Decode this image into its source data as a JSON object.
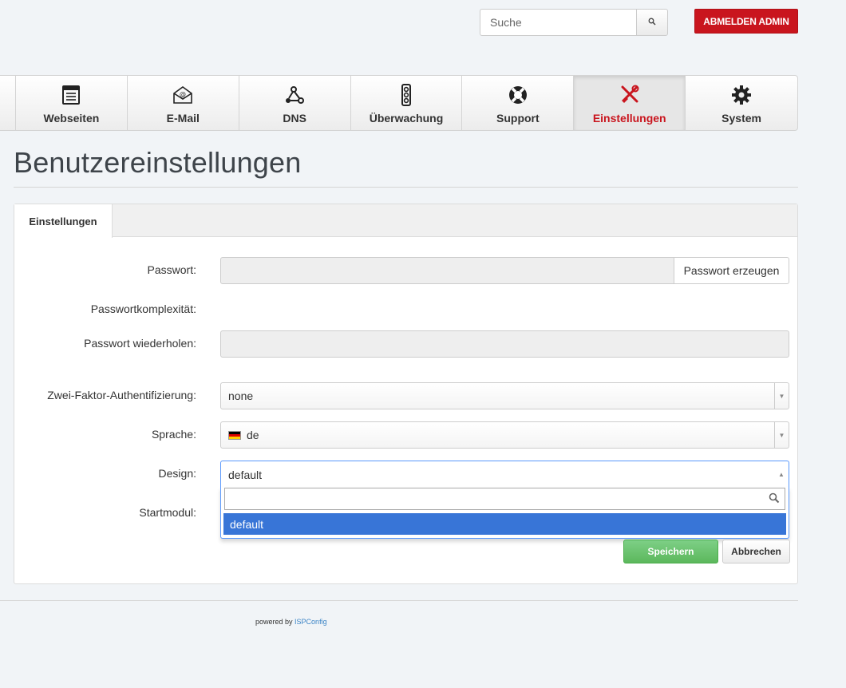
{
  "header": {
    "search_placeholder": "Suche",
    "search_button_icon": "search-icon",
    "logout_label": "ABMELDEN ADMIN",
    "logout_color": "#c9151e"
  },
  "nav": {
    "items": [
      {
        "label": "Webseiten",
        "icon": "web-page-icon",
        "active": false
      },
      {
        "label": "E-Mail",
        "icon": "email-envelope-icon",
        "active": false
      },
      {
        "label": "DNS",
        "icon": "network-nodes-icon",
        "active": false
      },
      {
        "label": "Überwachung",
        "icon": "traffic-light-icon",
        "active": false
      },
      {
        "label": "Support",
        "icon": "lifebuoy-icon",
        "active": false
      },
      {
        "label": "Einstellungen",
        "icon": "tools-icon",
        "active": true
      },
      {
        "label": "System",
        "icon": "gear-icon",
        "active": false
      }
    ],
    "active_color": "#c9151e"
  },
  "page": {
    "title": "Benutzereinstellungen"
  },
  "panel": {
    "tab_label": "Einstellungen",
    "form": {
      "password_label": "Passwort:",
      "password_value": "",
      "generate_password_label": "Passwort erzeugen",
      "complexity_label": "Passwortkomplexität:",
      "repeat_password_label": "Passwort wiederholen:",
      "repeat_password_value": "",
      "twofa_label": "Zwei-Faktor-Authentifizierung:",
      "twofa_value": "none",
      "language_label": "Sprache:",
      "language_value": "de",
      "design_label": "Design:",
      "design_value": "default",
      "design_search_value": "",
      "design_options": [
        "default"
      ],
      "startmodule_label": "Startmodul:"
    },
    "buttons": {
      "save_label": "Speichern",
      "cancel_label": "Abbrechen",
      "save_color": "#5cb85c"
    }
  },
  "footer": {
    "prefix": "powered by",
    "link_label": "ISPConfig"
  }
}
